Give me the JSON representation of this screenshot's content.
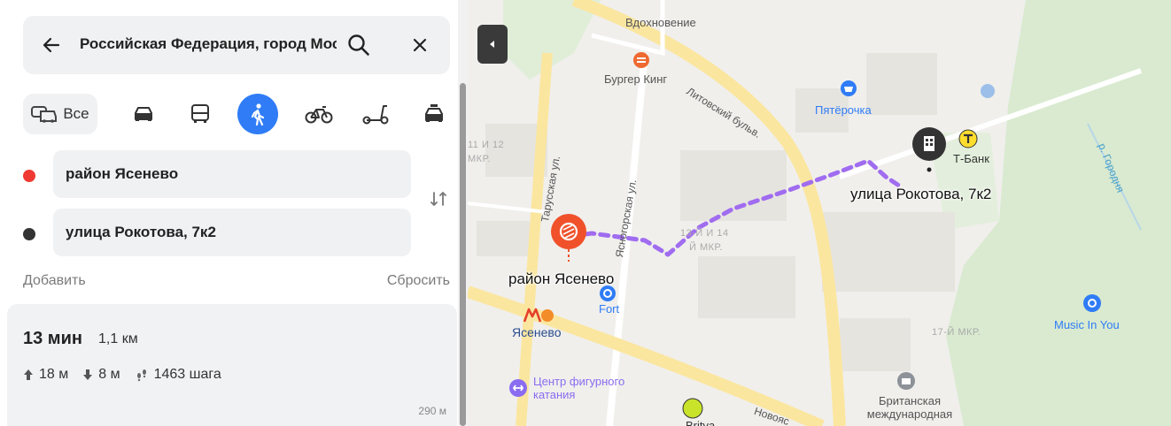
{
  "search": {
    "query": "Российская Федерация, город Москва, район Ясенево",
    "icons": {
      "back": "arrow-left-icon",
      "search": "search-icon",
      "close": "close-icon"
    }
  },
  "modes": [
    {
      "id": "all",
      "label": "Все",
      "icon": "multi-transport-icon",
      "selected": false
    },
    {
      "id": "car",
      "label": "",
      "icon": "car-icon",
      "selected": false
    },
    {
      "id": "transit",
      "label": "",
      "icon": "bus-icon",
      "selected": false
    },
    {
      "id": "walk",
      "label": "",
      "icon": "pedestrian-icon",
      "selected": true
    },
    {
      "id": "bike",
      "label": "",
      "icon": "bicycle-icon",
      "selected": false
    },
    {
      "id": "scooter",
      "label": "",
      "icon": "scooter-icon",
      "selected": false
    },
    {
      "id": "taxi",
      "label": "",
      "icon": "taxi-icon",
      "selected": false
    }
  ],
  "route": {
    "from": "район Ясенево",
    "to": "улица Рокотова, 7к2",
    "add_label": "Добавить",
    "reset_label": "Сбросить"
  },
  "summary": {
    "time": "13 мин",
    "distance": "1,1 км",
    "ascent": "18 м",
    "descent": "8 м",
    "steps": "1463 шага",
    "scale": "290 м"
  },
  "map": {
    "pois": {
      "vdohnovenie": "Вдохновение",
      "burger_king": "Бургер Кинг",
      "pyaterochka": "Пятёрочка",
      "tbank": "Т-Банк",
      "fort": "Fort",
      "metro": "Ясенево",
      "skating": "Центр фигурного катания",
      "music": "Music In You",
      "school": "Британская международная",
      "britva": "Britva"
    },
    "streets": {
      "litovsky": "Литовский бульв.",
      "tarusskaya": "Тарусская ул.",
      "yasnogorskaya": "Ясногорская ул.",
      "novoyasenevsky": "Новояс"
    },
    "districts": {
      "d1": "11 И 12",
      "d1b": "МКР.",
      "d2": "13-Й И 14",
      "d2b": "Й МКР.",
      "d3": "17-Й МКР."
    },
    "river": "р. Городня",
    "start_label": "район Ясенево",
    "end_label": "улица Рокотова, 7к2",
    "colors": {
      "route": "#a06cf0",
      "start_pin": "#f0512a",
      "end_pin": "#333333",
      "park": "#dcebd0",
      "road": "#fbe9a6",
      "accent": "#2f7cf6"
    }
  }
}
